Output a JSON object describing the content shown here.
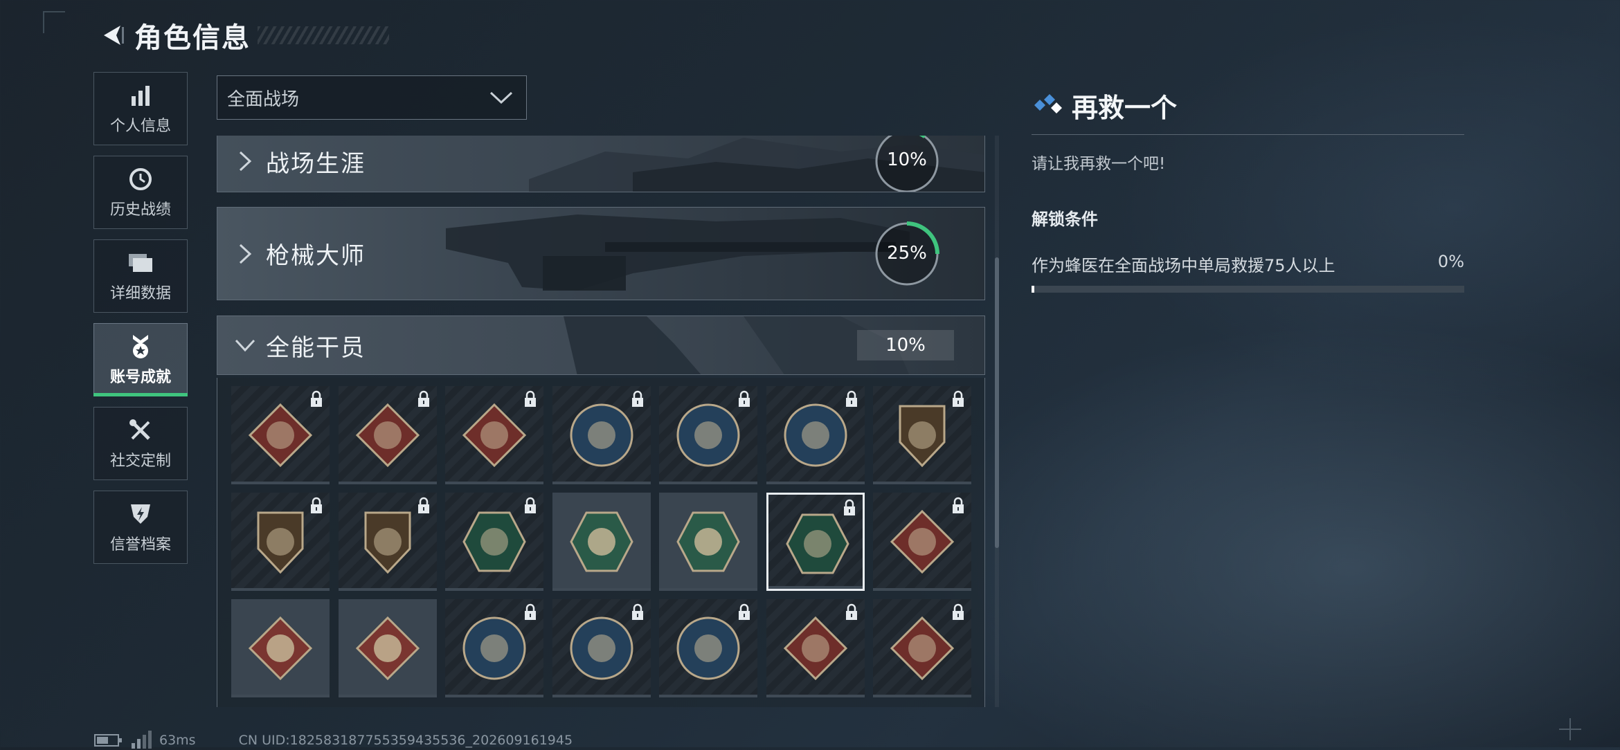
{
  "header": {
    "title": "角色信息"
  },
  "sidebar": {
    "items": [
      {
        "label": "个人信息",
        "icon": "bar-chart-icon",
        "active": false
      },
      {
        "label": "历史战绩",
        "icon": "clock-icon",
        "active": false
      },
      {
        "label": "详细数据",
        "icon": "folders-icon",
        "active": false
      },
      {
        "label": "账号成就",
        "icon": "medal-star-icon",
        "active": true
      },
      {
        "label": "社交定制",
        "icon": "tools-icon",
        "active": false
      },
      {
        "label": "信誉档案",
        "icon": "shield-bolt-icon",
        "active": false
      }
    ]
  },
  "mode_select": {
    "value": "全面战场"
  },
  "categories": [
    {
      "name": "战场生涯",
      "percent_label": "10%",
      "progress": 0.1,
      "expanded": false
    },
    {
      "name": "枪械大师",
      "percent_label": "25%",
      "progress": 0.25,
      "expanded": false
    },
    {
      "name": "全能干员",
      "percent_label": "10%",
      "progress": 0.1,
      "expanded": true
    }
  ],
  "medals": [
    {
      "icon": "wolf-medal-icon",
      "locked": true,
      "shape": "diamond",
      "color": "#6e2e2a"
    },
    {
      "icon": "wolf-medal-icon",
      "locked": true,
      "shape": "diamond",
      "color": "#6e2e2a"
    },
    {
      "icon": "runner-medal-icon",
      "locked": true,
      "shape": "diamond",
      "color": "#6e2e2a"
    },
    {
      "icon": "eagle-medal-icon",
      "locked": true,
      "shape": "circle",
      "color": "#24405a"
    },
    {
      "icon": "eagle-medal-icon",
      "locked": true,
      "shape": "circle",
      "color": "#24405a"
    },
    {
      "icon": "arrow-medal-icon",
      "locked": true,
      "shape": "circle",
      "color": "#24405a"
    },
    {
      "icon": "lion-medal-icon",
      "locked": true,
      "shape": "shield",
      "color": "#4a3a28"
    },
    {
      "icon": "lion-medal-icon",
      "locked": true,
      "shape": "shield",
      "color": "#4a3a28"
    },
    {
      "icon": "target-medal-icon",
      "locked": true,
      "shape": "shield",
      "color": "#4a3a28"
    },
    {
      "icon": "wasp-medal-icon",
      "locked": true,
      "shape": "hexagon",
      "color": "#1f4a3c"
    },
    {
      "icon": "wasp-medal-icon",
      "locked": false,
      "shape": "hexagon",
      "color": "#2a5a48"
    },
    {
      "icon": "medic-medal-icon",
      "locked": false,
      "shape": "hexagon",
      "color": "#2a5a48"
    },
    {
      "icon": "rescue-medal-icon",
      "locked": true,
      "shape": "hexagon",
      "color": "#1f4a3c",
      "selected": true
    },
    {
      "icon": "dragon-medal-icon",
      "locked": true,
      "shape": "diamond",
      "color": "#6e2e2a"
    },
    {
      "icon": "dragon-medal-icon",
      "locked": false,
      "shape": "diamond",
      "color": "#7a3530"
    },
    {
      "icon": "runner-medal-icon",
      "locked": false,
      "shape": "diamond",
      "color": "#7a3530"
    },
    {
      "icon": "cat-medal-icon",
      "locked": true,
      "shape": "circle",
      "color": "#24405a"
    },
    {
      "icon": "cat-medal-icon",
      "locked": true,
      "shape": "circle",
      "color": "#24405a"
    },
    {
      "icon": "shield-medal-icon",
      "locked": true,
      "shape": "circle",
      "color": "#24405a"
    },
    {
      "icon": "fist-medal-icon",
      "locked": true,
      "shape": "diamond",
      "color": "#6e2e2a"
    },
    {
      "icon": "fist-medal-icon",
      "locked": true,
      "shape": "diamond",
      "color": "#6e2e2a"
    }
  ],
  "detail": {
    "title": "再救一个",
    "description": "请让我再救一个吧!",
    "conditions_heading": "解锁条件",
    "condition": "作为蜂医在全面战场中单局救援75人以上",
    "condition_percent": "0%",
    "condition_progress": 0.0
  },
  "footer": {
    "ping": "63ms",
    "uid": "CN UID:182583187755359435536_202609161945"
  }
}
